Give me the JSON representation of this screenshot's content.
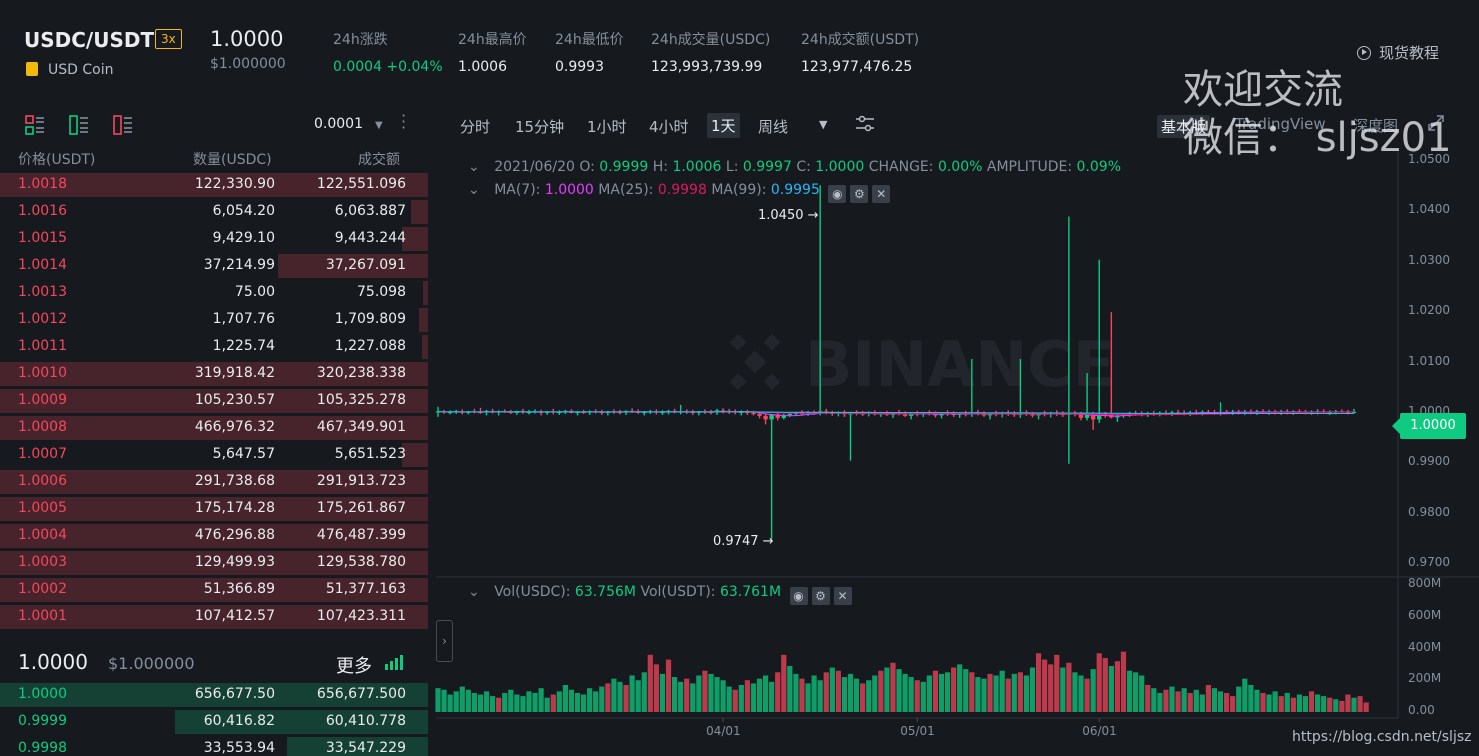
{
  "header": {
    "symbol": "USDC/USDT",
    "leverage": "3x",
    "coin_name": "USD Coin",
    "last_price": "1.0000",
    "last_price_usd": "$1.000000",
    "stats": [
      {
        "label": "24h涨跌",
        "value": "0.0004 +0.04%",
        "color": "green"
      },
      {
        "label": "24h最高价",
        "value": "1.0006"
      },
      {
        "label": "24h最低价",
        "value": "0.9993"
      },
      {
        "label": "24h成交量(USDC)",
        "value": "123,993,739.99"
      },
      {
        "label": "24h成交额(USDT)",
        "value": "123,977,476.25"
      }
    ],
    "tutorial": "现货教程"
  },
  "watermark": {
    "line1": "欢迎交流",
    "line2": "微信： sljsz01"
  },
  "credit": "https://blog.csdn.net/sljsz",
  "orderbook": {
    "precision": "0.0001",
    "headers": {
      "price": "价格(USDT)",
      "amount": "数量(USDC)",
      "total": "成交额"
    },
    "asks": [
      {
        "price": "1.0018",
        "amount": "122,330.90",
        "total": "122,551.096",
        "depth": 1.0
      },
      {
        "price": "1.0016",
        "amount": "6,054.20",
        "total": "6,063.887",
        "depth": 0.04
      },
      {
        "price": "1.0015",
        "amount": "9,429.10",
        "total": "9,443.244",
        "depth": 0.06
      },
      {
        "price": "1.0014",
        "amount": "37,214.99",
        "total": "37,267.091",
        "depth": 0.35
      },
      {
        "price": "1.0013",
        "amount": "75.00",
        "total": "75.098",
        "depth": 0.0
      },
      {
        "price": "1.0012",
        "amount": "1,707.76",
        "total": "1,709.809",
        "depth": 0.02
      },
      {
        "price": "1.0011",
        "amount": "1,225.74",
        "total": "1,227.088",
        "depth": 0.015
      },
      {
        "price": "1.0010",
        "amount": "319,918.42",
        "total": "320,238.338",
        "depth": 1.0
      },
      {
        "price": "1.0009",
        "amount": "105,230.57",
        "total": "105,325.278",
        "depth": 1.0
      },
      {
        "price": "1.0008",
        "amount": "466,976.32",
        "total": "467,349.901",
        "depth": 1.0
      },
      {
        "price": "1.0007",
        "amount": "5,647.57",
        "total": "5,651.523",
        "depth": 0.06
      },
      {
        "price": "1.0006",
        "amount": "291,738.68",
        "total": "291,913.723",
        "depth": 1.0
      },
      {
        "price": "1.0005",
        "amount": "175,174.28",
        "total": "175,261.867",
        "depth": 1.0
      },
      {
        "price": "1.0004",
        "amount": "476,296.88",
        "total": "476,487.399",
        "depth": 1.0
      },
      {
        "price": "1.0003",
        "amount": "129,499.93",
        "total": "129,538.780",
        "depth": 1.0
      },
      {
        "price": "1.0002",
        "amount": "51,366.89",
        "total": "51,377.163",
        "depth": 1.0
      },
      {
        "price": "1.0001",
        "amount": "107,412.57",
        "total": "107,423.311",
        "depth": 1.0
      }
    ],
    "mid_price": "1.0000",
    "mid_price_usd": "$1.000000",
    "more": "更多",
    "bids": [
      {
        "price": "1.0000",
        "amount": "656,677.50",
        "total": "656,677.500",
        "depth": 1.0
      },
      {
        "price": "0.9999",
        "amount": "60,416.82",
        "total": "60,410.778",
        "depth": 0.59
      },
      {
        "price": "0.9998",
        "amount": "33,553.94",
        "total": "33,547.229",
        "depth": 0.33
      }
    ]
  },
  "chart_toolbar": {
    "intervals": [
      "分时",
      "15分钟",
      "1小时",
      "4小时",
      "1天",
      "周线"
    ],
    "active_interval": "1天",
    "versions": [
      "基本版",
      "TradingView",
      "深度图"
    ]
  },
  "chart_data": {
    "type": "candlestick",
    "legend": {
      "date": "2021/06/20",
      "open": "0.9999",
      "high": "1.0006",
      "low": "0.9997",
      "close": "1.0000",
      "change": "0.00%",
      "amplitude": "0.09%",
      "ma7": "1.0000",
      "ma25": "0.9998",
      "ma99": "0.9995"
    },
    "volume_legend": {
      "vol_usdc": "63.756M",
      "vol_usdt": "63.761M"
    },
    "price_axis": [
      "1.0500",
      "1.0400",
      "1.0300",
      "1.0200",
      "1.0100",
      "1.0000",
      "0.9900",
      "0.9800",
      "0.9700"
    ],
    "volume_axis": [
      "800M",
      "600M",
      "400M",
      "200M",
      "0.00"
    ],
    "date_axis": [
      "04/01",
      "05/01",
      "06/01"
    ],
    "current_price": "1.0000",
    "high_marker": "1.0450",
    "low_marker": "0.9747",
    "price_range": [
      0.968,
      1.052
    ],
    "volume_range": [
      0,
      800
    ],
    "candles": [
      [
        1.0,
        1.001,
        0.999,
        1.0001
      ],
      [
        1.0001,
        1.0004,
        0.9996,
        0.9999
      ],
      [
        0.9999,
        1.0003,
        0.9995,
        1.0
      ],
      [
        1.0,
        1.0004,
        0.9996,
        1.0001
      ],
      [
        1.0001,
        1.0005,
        0.9995,
        0.9998
      ],
      [
        0.9998,
        1.0002,
        0.9995,
        1.0001
      ],
      [
        1.0001,
        1.0006,
        0.9997,
        1.0
      ],
      [
        1.0,
        1.0008,
        0.9996,
        0.9999
      ],
      [
        0.9999,
        1.0004,
        0.9993,
        1.0002
      ],
      [
        1.0002,
        1.0006,
        0.9997,
        0.9999
      ],
      [
        0.9999,
        1.0003,
        0.9993,
        1.0001
      ],
      [
        1.0001,
        1.0005,
        0.9998,
        1.0
      ],
      [
        1.0,
        1.0004,
        0.9996,
        0.9998
      ],
      [
        0.9998,
        1.0002,
        0.9994,
        1.0002
      ],
      [
        1.0002,
        1.0006,
        0.9996,
        0.9999
      ],
      [
        0.9999,
        1.0004,
        0.9995,
        1.0
      ],
      [
        1.0,
        1.0005,
        0.9997,
        1.0001
      ],
      [
        1.0001,
        1.0004,
        0.9993,
        0.9998
      ],
      [
        0.9998,
        1.0002,
        0.9994,
        1.0001
      ],
      [
        1.0001,
        1.0006,
        0.9995,
        0.9999
      ],
      [
        0.9999,
        1.0003,
        0.9994,
        1.0
      ],
      [
        1.0,
        1.0004,
        0.9996,
        1.0002
      ],
      [
        1.0002,
        1.0005,
        0.9997,
        0.9998
      ],
      [
        0.9998,
        1.0002,
        0.9993,
        1.0
      ],
      [
        1.0,
        1.0004,
        0.9996,
        0.9999
      ],
      [
        0.9999,
        1.0003,
        0.9994,
        1.0001
      ],
      [
        1.0001,
        1.0005,
        0.9997,
        1.0
      ],
      [
        1.0,
        1.0004,
        0.9994,
        0.9998
      ],
      [
        0.9998,
        1.0002,
        0.9993,
        1.0001
      ],
      [
        1.0001,
        1.0005,
        0.9996,
        1.0
      ],
      [
        1.0,
        1.0004,
        0.9995,
        0.9999
      ],
      [
        0.9999,
        1.0003,
        0.9994,
        1.0002
      ],
      [
        1.0002,
        1.0007,
        0.9998,
        1.0001
      ],
      [
        1.0001,
        1.0005,
        0.9996,
        0.9998
      ],
      [
        0.9998,
        1.0002,
        0.9993,
        1.0
      ],
      [
        1.0,
        1.0004,
        0.9996,
        1.0001
      ],
      [
        1.0001,
        1.0005,
        0.9995,
        0.9999
      ],
      [
        0.9999,
        1.0003,
        0.9994,
        1.0
      ],
      [
        1.0,
        1.0004,
        0.9995,
        1.0002
      ],
      [
        1.0002,
        1.0006,
        0.9997,
        0.9999
      ],
      [
        0.9999,
        1.0014,
        0.9995,
        1.0001
      ],
      [
        1.0001,
        1.0005,
        0.9996,
        1.0
      ],
      [
        1.0,
        1.0004,
        0.9994,
        0.9998
      ],
      [
        0.9998,
        1.0002,
        0.9993,
        1.0001
      ],
      [
        1.0001,
        1.0005,
        0.9996,
        1.0
      ],
      [
        1.0,
        1.0004,
        0.9995,
        0.9999
      ],
      [
        0.9999,
        1.0006,
        0.9994,
        1.0003
      ],
      [
        1.0003,
        1.0007,
        0.9997,
        1.0002
      ],
      [
        1.0002,
        1.0006,
        0.9996,
        1.0001
      ],
      [
        1.0001,
        1.0005,
        0.9995,
        0.9999
      ],
      [
        0.9999,
        1.0003,
        0.9993,
        1.0
      ],
      [
        1.0,
        1.0004,
        0.9994,
        0.9998
      ],
      [
        0.9998,
        1.0002,
        0.9993,
        0.9996
      ],
      [
        0.9996,
        1.0,
        0.9987,
        0.9992
      ],
      [
        0.9992,
        0.9996,
        0.9975,
        0.9985
      ],
      [
        0.9985,
        0.9992,
        0.9747,
        0.9995
      ],
      [
        0.9995,
        0.9999,
        0.9983,
        0.9988
      ],
      [
        0.9988,
        0.9996,
        0.9985,
        0.9994
      ],
      [
        0.9994,
        0.9999,
        0.999,
        0.9996
      ],
      [
        0.9996,
        1.0,
        0.9992,
        0.9998
      ],
      [
        0.9998,
        1.0003,
        0.9994,
        0.9997
      ],
      [
        0.9997,
        1.0002,
        0.9992,
        0.9999
      ],
      [
        0.9999,
        1.0003,
        0.9994,
        0.9997
      ],
      [
        0.9997,
        1.045,
        0.9993,
        1.0001
      ],
      [
        1.0001,
        1.0006,
        0.9995,
        0.9998
      ],
      [
        0.9998,
        1.0002,
        0.9992,
        0.9996
      ],
      [
        0.9996,
        1.0001,
        0.9991,
        0.9999
      ],
      [
        0.9999,
        1.0003,
        0.999,
        0.9995
      ],
      [
        0.9995,
        1.0,
        0.9903,
        0.9999
      ],
      [
        0.9999,
        1.0003,
        0.9993,
        0.9997
      ],
      [
        0.9997,
        1.0002,
        0.9992,
        0.9996
      ],
      [
        0.9996,
        1.0001,
        0.9991,
        0.9998
      ],
      [
        0.9998,
        1.0003,
        0.9993,
        0.9995
      ],
      [
        0.9995,
        1.0,
        0.999,
        0.9997
      ],
      [
        0.9997,
        1.0002,
        0.9992,
        0.9994
      ],
      [
        0.9994,
        0.9999,
        0.9988,
        0.9999
      ],
      [
        0.9999,
        1.0004,
        0.9993,
        0.9996
      ],
      [
        0.9996,
        1.0001,
        0.999,
        0.9992
      ],
      [
        0.9992,
        0.9998,
        0.9985,
        0.9997
      ],
      [
        0.9997,
        1.0002,
        0.9991,
        0.9995
      ],
      [
        0.9995,
        1.0,
        0.999,
        0.9999
      ],
      [
        0.9999,
        1.0003,
        0.9993,
        0.9996
      ],
      [
        0.9996,
        1.0001,
        0.9989,
        0.9993
      ],
      [
        0.9993,
        0.9999,
        0.9987,
        0.9998
      ],
      [
        0.9998,
        1.0003,
        0.9992,
        0.9996
      ],
      [
        0.9996,
        1.0001,
        0.999,
        0.9994
      ],
      [
        0.9994,
        0.9999,
        0.9988,
        0.9997
      ],
      [
        0.9997,
        1.0002,
        0.9991,
        0.9995
      ],
      [
        0.9995,
        1.0105,
        0.999,
        0.9999
      ],
      [
        0.9999,
        1.0004,
        0.9993,
        0.9996
      ],
      [
        0.9996,
        1.0001,
        0.999,
        0.9993
      ],
      [
        0.9993,
        0.9998,
        0.9985,
        0.9997
      ],
      [
        0.9997,
        1.0002,
        0.9991,
        0.9995
      ],
      [
        0.9995,
        1.0,
        0.9989,
        0.9998
      ],
      [
        0.9998,
        1.0003,
        0.9992,
        0.9996
      ],
      [
        0.9996,
        1.0001,
        0.999,
        0.9994
      ],
      [
        0.9994,
        1.0105,
        0.9988,
        0.9998
      ],
      [
        0.9998,
        1.0003,
        0.9992,
        0.9995
      ],
      [
        0.9995,
        1.0,
        0.9989,
        0.9993
      ],
      [
        0.9993,
        0.9998,
        0.9985,
        0.9997
      ],
      [
        0.9997,
        1.0002,
        0.9991,
        0.9995
      ],
      [
        0.9995,
        1.0,
        0.9989,
        0.9998
      ],
      [
        0.9998,
        1.0003,
        0.9992,
        0.9996
      ],
      [
        0.9996,
        1.0001,
        0.999,
        0.9994
      ],
      [
        0.9994,
        1.0388,
        0.9897,
        0.9997
      ],
      [
        0.9997,
        1.0002,
        0.9991,
        0.9995
      ],
      [
        0.9995,
        1.0,
        0.9983,
        0.9988
      ],
      [
        0.9988,
        1.0077,
        0.9983,
        0.9995
      ],
      [
        0.9995,
        1.0,
        0.9964,
        0.9985
      ],
      [
        0.9985,
        1.0302,
        0.9978,
        0.9997
      ],
      [
        0.9997,
        1.0,
        0.9988,
        0.9994
      ],
      [
        0.9994,
        1.0198,
        0.9987,
        0.9989
      ],
      [
        0.9989,
        0.9996,
        0.998,
        0.9993
      ],
      [
        0.9993,
        0.9998,
        0.9988,
        0.9995
      ],
      [
        0.9995,
        1.0,
        0.999,
        0.9997
      ],
      [
        0.9997,
        1.0002,
        0.9992,
        0.9996
      ],
      [
        0.9996,
        1.0001,
        0.9991,
        0.9995
      ],
      [
        0.9995,
        1.0,
        0.999,
        0.9997
      ],
      [
        0.9997,
        1.0002,
        0.9992,
        0.9996
      ],
      [
        0.9996,
        1.0001,
        0.9991,
        0.9998
      ],
      [
        0.9998,
        1.0003,
        0.9993,
        0.9997
      ],
      [
        0.9997,
        1.0002,
        0.9992,
        0.9999
      ],
      [
        0.9999,
        1.0004,
        0.9994,
        0.9998
      ],
      [
        0.9998,
        1.0003,
        0.9993,
        0.9997
      ],
      [
        0.9997,
        1.0002,
        0.9992,
        0.9999
      ],
      [
        0.9999,
        1.0004,
        0.9994,
        0.9998
      ],
      [
        0.9998,
        1.0003,
        0.9993,
        1.0
      ],
      [
        1.0,
        1.0004,
        0.9995,
        0.9999
      ],
      [
        0.9999,
        1.0004,
        0.9994,
        0.9998
      ],
      [
        0.9998,
        1.0019,
        0.9993,
        1.0
      ],
      [
        1.0,
        1.0004,
        0.9995,
        0.9999
      ],
      [
        0.9999,
        1.0004,
        0.9994,
        1.0
      ],
      [
        1.0,
        1.0004,
        0.9995,
        0.9999
      ],
      [
        0.9999,
        1.0004,
        0.9994,
        1.0
      ],
      [
        1.0,
        1.0005,
        0.9995,
        0.9999
      ],
      [
        0.9999,
        1.0004,
        0.9994,
        1.0001
      ],
      [
        1.0001,
        1.0005,
        0.9996,
        0.9999
      ],
      [
        0.9999,
        1.0004,
        0.9994,
        1.0
      ],
      [
        1.0,
        1.0004,
        0.9995,
        0.9999
      ],
      [
        0.9999,
        1.0004,
        0.9994,
        1.0
      ],
      [
        1.0,
        1.0005,
        0.9995,
        0.9999
      ],
      [
        0.9999,
        1.0003,
        0.9994,
        1.0001
      ],
      [
        1.0001,
        1.0005,
        0.9996,
        1.0
      ],
      [
        1.0,
        1.0004,
        0.9995,
        0.9999
      ],
      [
        0.9999,
        1.0003,
        0.9994,
        1.0
      ],
      [
        1.0,
        1.0005,
        0.9995,
        1.0001
      ],
      [
        1.0001,
        1.0005,
        0.9996,
        0.9999
      ],
      [
        0.9999,
        1.0003,
        0.9994,
        1.0
      ],
      [
        1.0,
        1.0004,
        0.9995,
        1.0001
      ],
      [
        1.0001,
        1.0005,
        0.9996,
        1.0
      ],
      [
        1.0,
        1.0004,
        0.9995,
        0.9999
      ],
      [
        0.9999,
        1.0006,
        0.9997,
        1.0
      ]
    ],
    "volumes": [
      150,
      140,
      110,
      130,
      160,
      140,
      120,
      110,
      130,
      100,
      90,
      120,
      140,
      110,
      100,
      130,
      120,
      150,
      90,
      110,
      130,
      170,
      140,
      120,
      110,
      150,
      130,
      160,
      180,
      210,
      190,
      170,
      230,
      200,
      250,
      360,
      300,
      240,
      330,
      220,
      190,
      210,
      180,
      230,
      260,
      240,
      220,
      200,
      160,
      140,
      170,
      200,
      180,
      210,
      230,
      190,
      250,
      360,
      290,
      240,
      210,
      180,
      230,
      200,
      250,
      280,
      260,
      220,
      240,
      210,
      180,
      200,
      230,
      260,
      280,
      310,
      270,
      240,
      220,
      200,
      190,
      230,
      260,
      240,
      250,
      280,
      300,
      270,
      250,
      220,
      210,
      240,
      230,
      260,
      210,
      240,
      250,
      230,
      280,
      370,
      330,
      300,
      360,
      280,
      310,
      250,
      230,
      210,
      270,
      370,
      340,
      290,
      320,
      380,
      260,
      250,
      230,
      170,
      150,
      120,
      140,
      160,
      130,
      150,
      120,
      140,
      110,
      170,
      150,
      130,
      120,
      100,
      160,
      210,
      170,
      140,
      120,
      110,
      130,
      100,
      120,
      90,
      110,
      100,
      130,
      110,
      100,
      90,
      80,
      70,
      110,
      90,
      100,
      60
    ],
    "volume_up": [
      1,
      1,
      1,
      1,
      1,
      1,
      1,
      1,
      1,
      1,
      0,
      1,
      1,
      1,
      1,
      1,
      1,
      1,
      1,
      0,
      1,
      1,
      1,
      1,
      1,
      1,
      1,
      1,
      0,
      1,
      1,
      0,
      1,
      1,
      1,
      0,
      0,
      1,
      0,
      1,
      1,
      0,
      1,
      1,
      0,
      1,
      1,
      1,
      1,
      0,
      1,
      0,
      1,
      1,
      1,
      1,
      0,
      0,
      1,
      1,
      0,
      1,
      1,
      1,
      0,
      1,
      0,
      1,
      1,
      1,
      0,
      1,
      1,
      0,
      1,
      0,
      1,
      1,
      1,
      0,
      1,
      1,
      0,
      1,
      1,
      0,
      1,
      1,
      0,
      1,
      1,
      0,
      1,
      1,
      0,
      1,
      0,
      1,
      1,
      0,
      0,
      0,
      0,
      1,
      0,
      1,
      1,
      0,
      1,
      0,
      0,
      1,
      0,
      0,
      1,
      1,
      1,
      0,
      1,
      1,
      0,
      1,
      0,
      1,
      0,
      1,
      1,
      0,
      1,
      1,
      0,
      0,
      1,
      1,
      1,
      1,
      0,
      1,
      1,
      0,
      1,
      0,
      1,
      1,
      0,
      1,
      1,
      0,
      1,
      0,
      0,
      1
    ]
  }
}
